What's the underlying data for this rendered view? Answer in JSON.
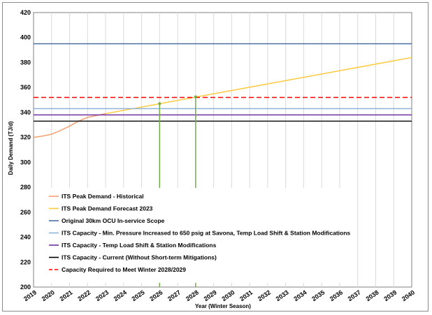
{
  "chart_data": {
    "type": "line",
    "title": "",
    "xlabel": "Year (Winter Season)",
    "ylabel": "Daily Demand (TJ/d)",
    "ylim": [
      200,
      420
    ],
    "y_ticks": [
      200,
      220,
      240,
      260,
      280,
      300,
      320,
      340,
      360,
      380,
      400,
      420
    ],
    "xlim": [
      2019,
      2040
    ],
    "x_ticks": [
      "2019",
      "2020",
      "2021",
      "2022",
      "2023",
      "2024",
      "2025",
      "2026",
      "2027",
      "2028",
      "2029",
      "2030",
      "2031",
      "2032",
      "2033",
      "2034",
      "2035",
      "2036",
      "2037",
      "2038",
      "2039",
      "2040"
    ],
    "grid": "vertical",
    "legend_position": "bottom-left",
    "series": [
      {
        "name": "ITS Peak Demand - Historical",
        "kind": "line",
        "color": "#f4a070",
        "dash": "solid",
        "x": [
          2019,
          2019.5,
          2020,
          2020.5,
          2021,
          2021.5,
          2022,
          2022.5,
          2023
        ],
        "y": [
          320,
          321,
          322.5,
          325.5,
          329,
          333,
          336,
          337.5,
          339
        ]
      },
      {
        "name": "ITS Peak Demand Forecast 2023",
        "kind": "line",
        "color": "#ffc93c",
        "dash": "solid",
        "x": [
          2023,
          2040
        ],
        "y": [
          339,
          384
        ]
      },
      {
        "name": "Original 30km OCU In-service Scope",
        "kind": "hline",
        "color": "#4a6fa5",
        "dash": "solid",
        "y": 395
      },
      {
        "name": "ITS Capacity - Min. Pressure Increased to 650 psig at Savona, Temp Load Shift & Station Modifications",
        "kind": "hline",
        "color": "#8fb3d9",
        "dash": "solid",
        "y": 343
      },
      {
        "name": "ITS Capacity - Temp Load Shift & Station Modifications",
        "kind": "hline",
        "color": "#7030a0",
        "dash": "solid",
        "y": 338
      },
      {
        "name": "ITS Capacity - Current (Without Short-term Mitigations)",
        "kind": "hline",
        "color": "#000000",
        "dash": "solid",
        "y": 333
      },
      {
        "name": "Capacity Required to Meet Winter 2028/2029",
        "kind": "hline",
        "color": "#ff0000",
        "dash": "dashed",
        "y": 352
      }
    ],
    "markers": [
      {
        "x": 2026,
        "y": 347,
        "color": "#70ad47"
      },
      {
        "x": 2028,
        "y": 352.5,
        "color": "#70ad47"
      }
    ]
  }
}
